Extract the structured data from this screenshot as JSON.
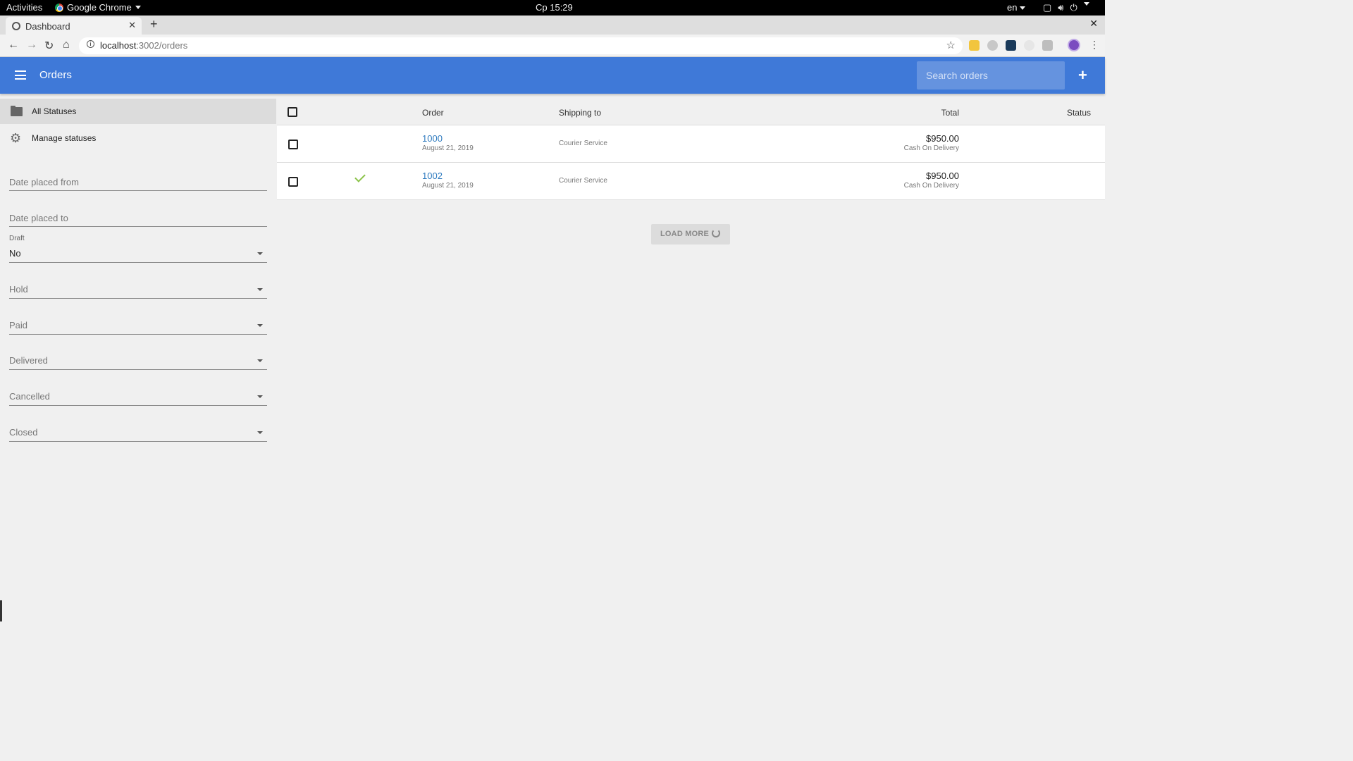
{
  "system": {
    "activities": "Activities",
    "app_name": "Google Chrome",
    "clock": "Ср 15:29",
    "lang": "en"
  },
  "browser": {
    "tab_title": "Dashboard",
    "url_host": "localhost",
    "url_path": ":3002/orders"
  },
  "appbar": {
    "title": "Orders",
    "search_placeholder": "Search orders"
  },
  "sidebar": {
    "items": [
      {
        "label": "All Statuses",
        "icon": "folder-icon"
      },
      {
        "label": "Manage statuses",
        "icon": "gear-icon"
      }
    ],
    "filters": {
      "date_from": "Date placed from",
      "date_to": "Date placed to",
      "draft_label": "Draft",
      "draft_value": "No",
      "hold": "Hold",
      "paid": "Paid",
      "delivered": "Delivered",
      "cancelled": "Cancelled",
      "closed": "Closed"
    }
  },
  "table": {
    "headers": {
      "order": "Order",
      "shipping": "Shipping to",
      "total": "Total",
      "status": "Status"
    },
    "rows": [
      {
        "order": "1000",
        "date": "August 21, 2019",
        "shipping": "Courier Service",
        "total": "$950.00",
        "payment": "Cash On Delivery",
        "checked_mark": false
      },
      {
        "order": "1002",
        "date": "August 21, 2019",
        "shipping": "Courier Service",
        "total": "$950.00",
        "payment": "Cash On Delivery",
        "checked_mark": true
      }
    ]
  },
  "load_more": "LOAD MORE",
  "colors": {
    "appbar": "#3f79d8",
    "link": "#2f7bbf",
    "check": "#8bc34a"
  }
}
